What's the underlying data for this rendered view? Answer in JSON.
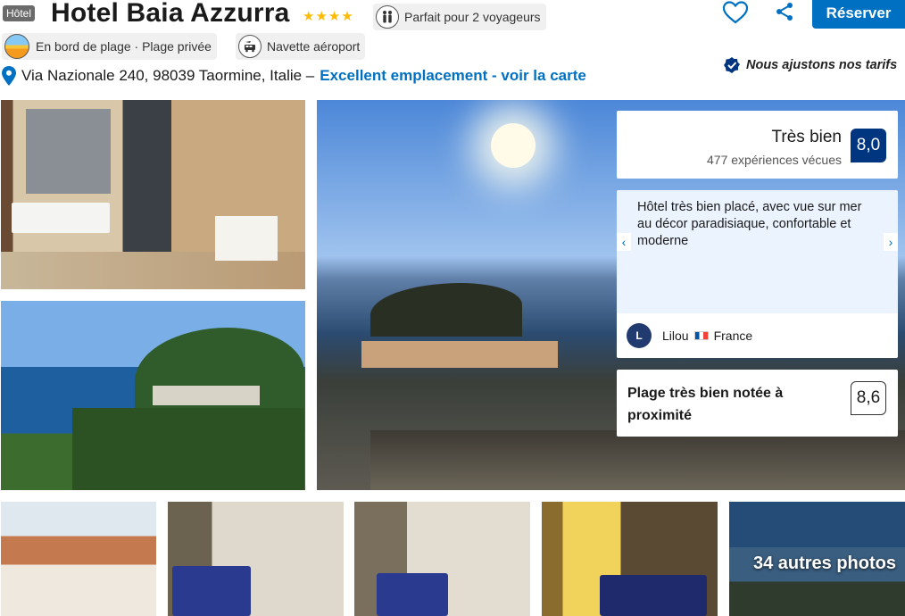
{
  "header": {
    "type_badge": "Hôtel",
    "hotel_name": "Hotel Baia Azzurra",
    "stars": 4,
    "travellers_label": "Parfait pour 2 voyageurs",
    "reserve_label": "Réserver",
    "beach_label": "En bord de plage · Plage privée",
    "shuttle_label": "Navette aéroport",
    "address": "Via Nazionale 240, 98039 Taormine, Italie –",
    "location_link": "Excellent emplacement - voir la carte",
    "price_note": "Nous ajustons nos tarifs"
  },
  "review": {
    "score_word": "Très bien",
    "score_count": "477 expériences vécues",
    "score": "8,0",
    "quote": "Hôtel très bien placé, avec vue sur mer au décor paradisiaque, confortable et moderne",
    "reviewer_initial": "L",
    "reviewer_name": "Lilou",
    "reviewer_country": "France",
    "beach_title": "Plage très bien notée à proximité",
    "beach_score": "8,6"
  },
  "gallery": {
    "more_photos": "34 autres photos"
  },
  "colors": {
    "brand_blue": "#0071c2",
    "score_navy": "#003580",
    "star_gold": "#febb02"
  },
  "icons": [
    "heart-icon",
    "share-icon",
    "travellers-icon",
    "beach-icon",
    "shuttle-icon",
    "map-pin-icon",
    "price-badge-icon",
    "chevron-left-icon",
    "chevron-right-icon"
  ]
}
